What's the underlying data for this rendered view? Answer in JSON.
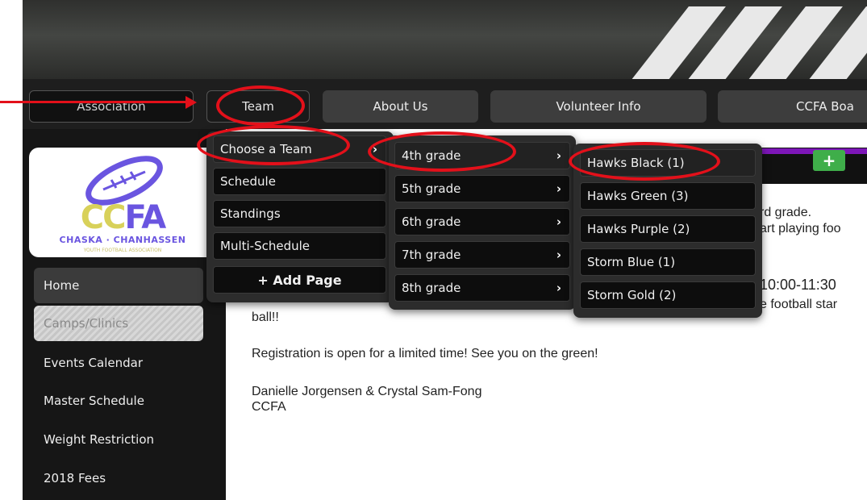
{
  "nav": {
    "items": [
      {
        "label": "Association"
      },
      {
        "label": "Team"
      },
      {
        "label": "About Us"
      },
      {
        "label": "Volunteer Info"
      },
      {
        "label": "CCFA Boa"
      }
    ]
  },
  "logo": {
    "text_cc": "CC",
    "text_fa": "FA",
    "subtitle": "CHASKA · CHANHASSEN",
    "tagline": "YOUTH FOOTBALL ASSOCIATION"
  },
  "sidebar": {
    "items": [
      {
        "label": "Home"
      },
      {
        "label": "Camps/Clinics"
      },
      {
        "label": "Events Calendar"
      },
      {
        "label": "Master Schedule"
      },
      {
        "label": "Weight Restriction"
      },
      {
        "label": "2018 Fees"
      }
    ]
  },
  "team_menu": {
    "items": [
      {
        "label": "Choose a Team"
      },
      {
        "label": "Schedule"
      },
      {
        "label": "Standings"
      },
      {
        "label": "Multi-Schedule"
      },
      {
        "label": "+ Add Page"
      }
    ]
  },
  "grade_menu": {
    "items": [
      {
        "label": "4th grade"
      },
      {
        "label": "5th grade"
      },
      {
        "label": "6th grade"
      },
      {
        "label": "7th grade"
      },
      {
        "label": "8th grade"
      }
    ]
  },
  "team_list": {
    "items": [
      {
        "label": "Hawks Black (1)"
      },
      {
        "label": "Hawks Green (3)"
      },
      {
        "label": "Hawks Purple (2)"
      },
      {
        "label": "Storm Blue (1)"
      },
      {
        "label": "Storm Gold (2)"
      }
    ]
  },
  "content": {
    "add_button": "+",
    "frag1": "rd grade.",
    "frag2": "art playing foo",
    "frag3": "10:00-11:30",
    "frag4": "e football star",
    "line_ball": "ball!!",
    "registration": "Registration is open for a limited time! See you on the green!",
    "signature_names": "Danielle Jorgensen & Crystal Sam-Fong",
    "signature_org": "CCFA"
  },
  "colors": {
    "annotation_red": "#e3101a",
    "accent_purple": "#7d16b8",
    "add_green": "#3fae4a"
  },
  "icons": {
    "chevron": "›",
    "submenu_arrow": "›"
  }
}
